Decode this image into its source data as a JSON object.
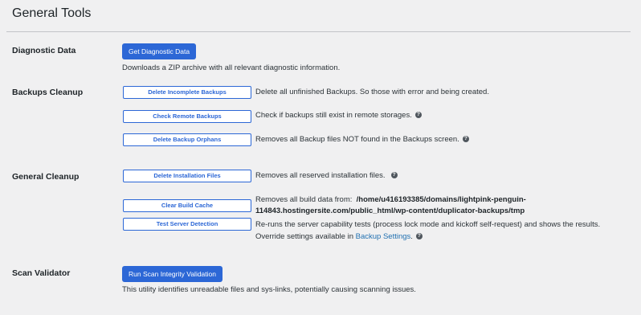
{
  "page": {
    "title": "General Tools"
  },
  "diagnostic": {
    "label": "Diagnostic Data",
    "button": "Get Diagnostic Data",
    "description": "Downloads a ZIP archive with all relevant diagnostic information."
  },
  "backups_cleanup": {
    "label": "Backups Cleanup",
    "delete_incomplete": {
      "button": "Delete Incomplete Backups",
      "description": "Delete all unfinished Backups. So those with error and being created."
    },
    "check_remote": {
      "button": "Check Remote Backups",
      "description": "Check if backups still exist in remote storages."
    },
    "delete_orphans": {
      "button": "Delete Backup Orphans",
      "description": "Removes all Backup files NOT found in the Backups screen."
    }
  },
  "general_cleanup": {
    "label": "General Cleanup",
    "delete_installation": {
      "button": "Delete Installation Files",
      "description": "Removes all reserved installation files."
    },
    "clear_build_cache": {
      "button": "Clear Build Cache",
      "description_prefix": "Removes all build data from:",
      "path_line1": "/home/u416193385/domains/lightpink-penguin-",
      "path_line2": "114843.hostingersite.com/public_html/wp-content/duplicator-backups/tmp"
    },
    "test_server": {
      "button": "Test Server Detection",
      "description_line1": "Re-runs the server capability tests (process lock mode and kickoff self-request) and shows the results.",
      "description_line2_prefix": "Override settings available in",
      "settings_link": "Backup Settings",
      "description_line2_suffix": "."
    }
  },
  "scan_validator": {
    "label": "Scan Validator",
    "button": "Run Scan Integrity Validation",
    "description": "This utility identifies unreadable files and sys-links, potentially causing scanning issues."
  },
  "icons": {
    "help": "question-circle-icon",
    "help_glyph": "?"
  },
  "colors": {
    "primary": "#2c67d6",
    "background": "#f0f0f1",
    "link": "#2271b1"
  }
}
